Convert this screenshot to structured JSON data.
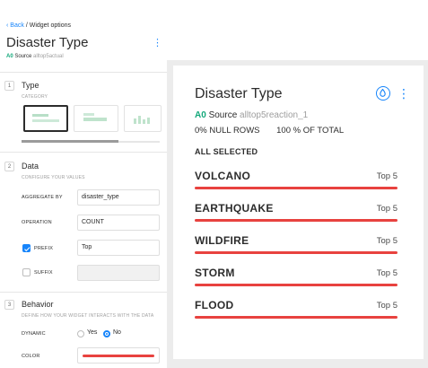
{
  "left_panel": {
    "back_label": "Back",
    "breadcrumb_current": "Widget options",
    "title": "Disaster Type",
    "source": {
      "badge": "A0",
      "label": "Source",
      "name": "alltop5actual"
    },
    "sections": {
      "type": {
        "number": "1",
        "title": "Type",
        "subtitle": "CATEGORY",
        "scroll_fraction": 0.7
      },
      "data": {
        "number": "2",
        "title": "Data",
        "subtitle": "CONFIGURE YOUR VALUES",
        "fields": {
          "aggregate_by": {
            "label": "AGGREGATE BY",
            "value": "disaster_type"
          },
          "operation": {
            "label": "OPERATION",
            "value": "COUNT"
          },
          "prefix": {
            "label": "PREFIX",
            "checked": true,
            "value": "Top"
          },
          "suffix": {
            "label": "SUFFIX",
            "checked": false,
            "value": ""
          }
        }
      },
      "behavior": {
        "number": "3",
        "title": "Behavior",
        "subtitle": "DEFINE HOW YOUR WIDGET INTERACTS WITH THE DATA",
        "dynamic": {
          "label": "DYNAMIC",
          "yes": "Yes",
          "no": "No",
          "selected": "No"
        },
        "color": {
          "label": "COLOR",
          "value": "#e8423f"
        }
      }
    }
  },
  "widget": {
    "title": "Disaster Type",
    "source": {
      "badge": "A0",
      "label": "Source",
      "name": "alltop5reaction_1"
    },
    "null_rows": "0% NULL ROWS",
    "percent_total": "100 % OF TOTAL",
    "all_selected": "ALL SELECTED",
    "bar_color": "#e8423f",
    "categories": [
      {
        "name": "VOLCANO",
        "value": "Top 5",
        "bar_fraction": 1.0
      },
      {
        "name": "EARTHQUAKE",
        "value": "Top 5",
        "bar_fraction": 1.0
      },
      {
        "name": "WILDFIRE",
        "value": "Top 5",
        "bar_fraction": 1.0
      },
      {
        "name": "STORM",
        "value": "Top 5",
        "bar_fraction": 1.0
      },
      {
        "name": "FLOOD",
        "value": "Top 5",
        "bar_fraction": 1.0
      }
    ]
  },
  "colors": {
    "accent": "#1785fb",
    "source_badge": "#13a87a",
    "bar": "#e8423f"
  },
  "icons": {
    "back": "chevron-left-icon",
    "menu": "more-vertical-icon",
    "color_by": "droplet-icon",
    "checkbox": "check-icon"
  }
}
